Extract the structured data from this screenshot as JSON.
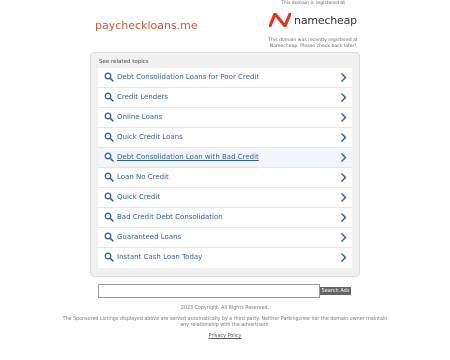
{
  "header": {
    "domain_name": "paycheckloans.me",
    "registrar_notice": "This domain is registered at",
    "registrar_name": "namecheap",
    "registrar_note": "This domain was recently registered at Namecheap. Please check back later!",
    "brand_color": "#d8542e",
    "logo_color": "#de3723"
  },
  "related": {
    "title": "See related topics",
    "items": [
      {
        "label": "Debt Consolidation Loans for Poor Credit"
      },
      {
        "label": "Credit Lenders"
      },
      {
        "label": "Online Loans"
      },
      {
        "label": "Quick Credit Loans"
      },
      {
        "label": "Debt Consolidation Loan with Bad Credit"
      },
      {
        "label": "Loan No Credit"
      },
      {
        "label": "Quick Credit"
      },
      {
        "label": "Bad Credit Debt Consolidation"
      },
      {
        "label": "Guaranteed Loans"
      },
      {
        "label": "Instant Cash Loan Today"
      }
    ],
    "link_color": "#2e5fa6"
  },
  "search": {
    "input_value": "",
    "placeholder": "",
    "button_label": "Search Ads"
  },
  "footer": {
    "copyright": "2023 Copyright. All Rights Reserved.",
    "disclaimer": "The Sponsored Listings displayed above are served automatically by a third party. Neither Parkingcrew nor the domain owner maintain any relationship with the advertisers.",
    "privacy_label": "Privacy Policy"
  }
}
